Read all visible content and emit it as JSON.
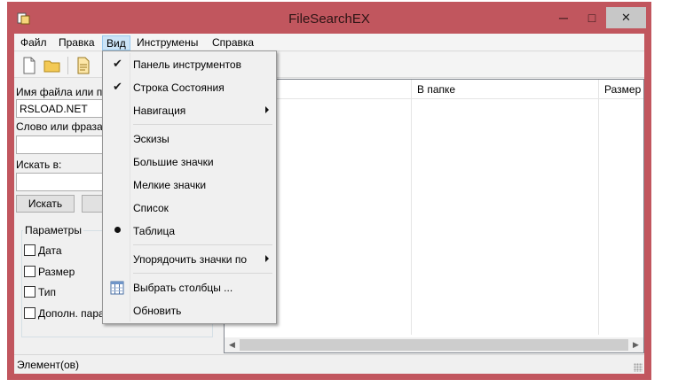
{
  "window": {
    "title": "FileSearchEX",
    "minimize_glyph": "─",
    "maximize_glyph": "□",
    "close_glyph": "✕",
    "frame_color": "#c1565e"
  },
  "menubar": {
    "items": [
      {
        "label": "Файл"
      },
      {
        "label": "Правка"
      },
      {
        "label": "Вид"
      },
      {
        "label": "Инструмены"
      },
      {
        "label": "Справка"
      }
    ]
  },
  "toolbar": {
    "buttons": [
      "new-file-icon",
      "open-folder-icon",
      "document-icon"
    ]
  },
  "search_panel": {
    "filename_label": "Имя файла или па",
    "filename_value": "RSLOAD.NET",
    "phrase_label": "Слово или фраза в",
    "phrase_value": "",
    "search_in_label": "Искать в:",
    "search_in_value": "",
    "search_button": "Искать",
    "params_group": "Параметры",
    "options": [
      {
        "label": "Дата",
        "checked": false
      },
      {
        "label": "Размер",
        "checked": false
      },
      {
        "label": "Тип",
        "checked": false
      },
      {
        "label": "Дополн. пара",
        "checked": false
      }
    ]
  },
  "results_table": {
    "columns": [
      {
        "label": ""
      },
      {
        "label": "В папке"
      },
      {
        "label": "Размер"
      }
    ],
    "rows": []
  },
  "view_menu": {
    "items": [
      {
        "label": "Панель инструментов",
        "mark": "check"
      },
      {
        "label": "Строка Состояния",
        "mark": "check"
      },
      {
        "label": "Навигация",
        "mark": "none",
        "submenu": true
      },
      {
        "label": "Эскизы",
        "mark": "none"
      },
      {
        "label": "Большие значки",
        "mark": "none"
      },
      {
        "label": "Мелкие значки",
        "mark": "none"
      },
      {
        "label": "Список",
        "mark": "none"
      },
      {
        "label": "Таблица",
        "mark": "bullet"
      },
      {
        "label": "Упорядочить значки по",
        "mark": "none",
        "submenu": true
      },
      {
        "label": "Выбрать столбцы ...",
        "mark": "icon",
        "icon": "columns-grid-icon"
      },
      {
        "label": "Обновить",
        "mark": "none"
      }
    ],
    "check_glyph": "✔"
  },
  "statusbar": {
    "text": "Элемент(ов)"
  }
}
